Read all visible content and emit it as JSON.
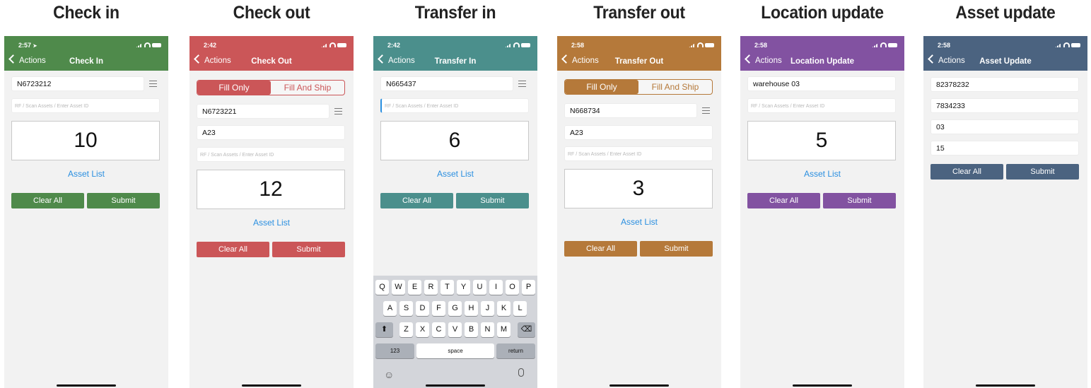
{
  "status_time": {
    "check_in": "2:57",
    "check_out": "2:42",
    "transfer_in": "2:42",
    "transfer_out": "2:58",
    "location_update": "2:58",
    "asset_update": "2:58"
  },
  "common": {
    "back_label": "Actions",
    "asset_list_label": "Asset List",
    "clear_label": "Clear All",
    "submit_label": "Submit",
    "scan_placeholder": "RF / Scan Assets / Enter Asset ID",
    "fill_only": "Fill Only",
    "fill_and_ship": "Fill And Ship"
  },
  "screens": {
    "check_in": {
      "caption": "Check in",
      "title": "Check In",
      "field1": "N6723212",
      "count": "10",
      "color": "#4f8a4b"
    },
    "check_out": {
      "caption": "Check out",
      "title": "Check Out",
      "field1": "N6723221",
      "field2": "A23",
      "count": "12",
      "color": "#cb5658"
    },
    "transfer_in": {
      "caption": "Transfer in",
      "title": "Transfer In",
      "field1": "N665437",
      "count": "6",
      "color": "#4b8f8c"
    },
    "transfer_out": {
      "caption": "Transfer out",
      "title": "Transfer Out",
      "field1": "N668734",
      "field2": "A23",
      "count": "3",
      "color": "#b5793a"
    },
    "location_update": {
      "caption": "Location update",
      "title": "Location Update",
      "field1": "warehouse 03",
      "count": "5",
      "color": "#8252a1"
    },
    "asset_update": {
      "caption": "Asset update",
      "title": "Asset Update",
      "field1": "82378232",
      "field2": "7834233",
      "field3": "03",
      "field4": "15",
      "color": "#4b6380"
    }
  },
  "keyboard": {
    "row1": [
      "Q",
      "W",
      "E",
      "R",
      "T",
      "Y",
      "U",
      "I",
      "O",
      "P"
    ],
    "row2": [
      "A",
      "S",
      "D",
      "F",
      "G",
      "H",
      "J",
      "K",
      "L"
    ],
    "row3": [
      "Z",
      "X",
      "C",
      "V",
      "B",
      "N",
      "M"
    ],
    "numbers_key": "123",
    "space_key": "space",
    "return_key": "return"
  },
  "icons": [
    "chevron-left-icon",
    "signal-icon",
    "wifi-icon",
    "battery-icon",
    "list-icon",
    "shift-icon",
    "backspace-icon",
    "emoji-icon",
    "microphone-icon",
    "location-arrow-icon"
  ]
}
